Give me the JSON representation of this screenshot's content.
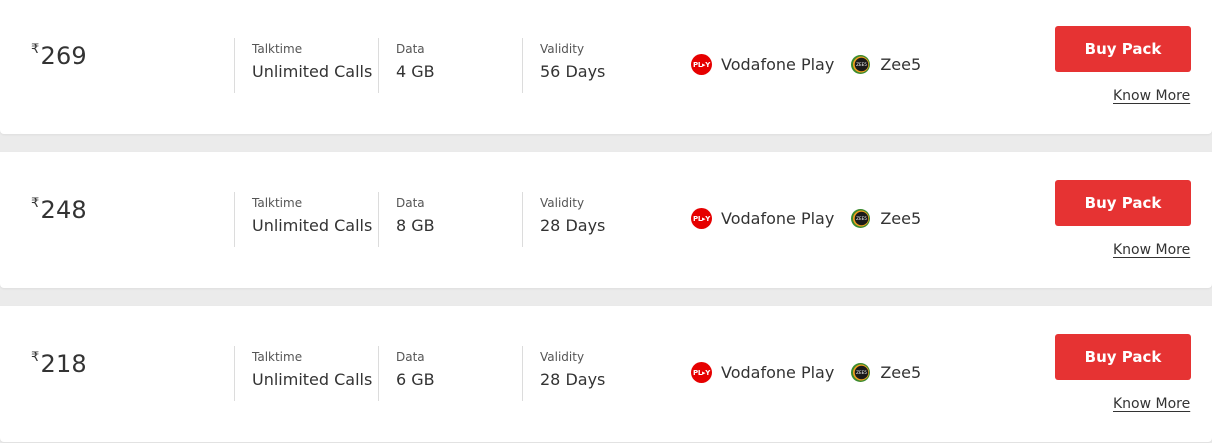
{
  "currency_symbol": "₹",
  "colors": {
    "buy_button": "#e63333",
    "vodafone_play_icon": "#e60000",
    "background": "#ebebeb"
  },
  "labels": {
    "talktime": "Talktime",
    "data": "Data",
    "validity": "Validity",
    "buy_button": "Buy Pack",
    "know_more": "Know More"
  },
  "plans": [
    {
      "price": "269",
      "talktime": "Unlimited Calls",
      "data": "4 GB",
      "validity": "56 Days",
      "benefits": [
        {
          "name": "Vodafone Play",
          "icon": "vodafone-play-icon",
          "icon_text": "PL▸Y"
        },
        {
          "name": "Zee5",
          "icon": "zee5-icon",
          "icon_text": "ZEE5"
        }
      ]
    },
    {
      "price": "248",
      "talktime": "Unlimited Calls",
      "data": "8 GB",
      "validity": "28 Days",
      "benefits": [
        {
          "name": "Vodafone Play",
          "icon": "vodafone-play-icon",
          "icon_text": "PL▸Y"
        },
        {
          "name": "Zee5",
          "icon": "zee5-icon",
          "icon_text": "ZEE5"
        }
      ]
    },
    {
      "price": "218",
      "talktime": "Unlimited Calls",
      "data": "6 GB",
      "validity": "28 Days",
      "benefits": [
        {
          "name": "Vodafone Play",
          "icon": "vodafone-play-icon",
          "icon_text": "PL▸Y"
        },
        {
          "name": "Zee5",
          "icon": "zee5-icon",
          "icon_text": "ZEE5"
        }
      ]
    }
  ]
}
